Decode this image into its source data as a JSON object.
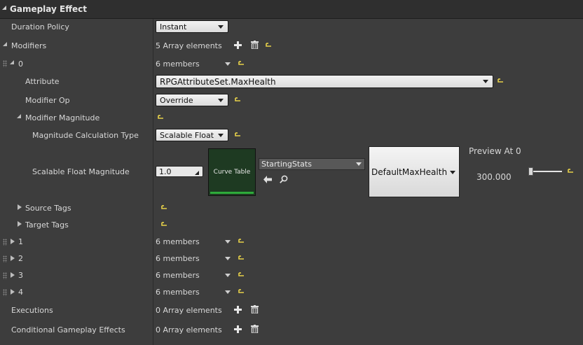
{
  "header": {
    "title": "Gameplay Effect"
  },
  "properties": {
    "duration_policy": {
      "label": "Duration Policy",
      "value": "Instant"
    },
    "modifiers": {
      "label": "Modifiers",
      "count_text": "5 Array elements"
    },
    "modifier_0": {
      "index": "0",
      "members_text": "6 members",
      "attribute": {
        "label": "Attribute",
        "value": "RPGAttributeSet.MaxHealth"
      },
      "modifier_op": {
        "label": "Modifier Op",
        "value": "Override"
      },
      "modifier_magnitude": {
        "label": "Modifier Magnitude"
      },
      "calc_type": {
        "label": "Magnitude Calculation Type",
        "value": "Scalable Float"
      },
      "scalable_float": {
        "label": "Scalable Float Magnitude",
        "value": "1.0",
        "curve_table_label": "Curve Table",
        "curve_table_value": "StartingStats",
        "row_name": "DefaultMaxHealth",
        "preview_label": "Preview At 0",
        "preview_value": "300.000",
        "preview_slider_level": 0
      },
      "source_tags": {
        "label": "Source Tags"
      },
      "target_tags": {
        "label": "Target Tags"
      }
    },
    "collapsed_modifiers": [
      {
        "index": "1",
        "members_text": "6 members"
      },
      {
        "index": "2",
        "members_text": "6 members"
      },
      {
        "index": "3",
        "members_text": "6 members"
      },
      {
        "index": "4",
        "members_text": "6 members"
      }
    ],
    "executions": {
      "label": "Executions",
      "count_text": "0 Array elements"
    },
    "conditional_effects": {
      "label": "Conditional Gameplay Effects",
      "count_text": "0 Array elements"
    }
  },
  "colors": {
    "panel_bg": "#3d3d3d",
    "header_bg": "#2f2f2f",
    "reset_arrow": "#e8d24a",
    "curve_table_accent": "#2eab3a"
  }
}
